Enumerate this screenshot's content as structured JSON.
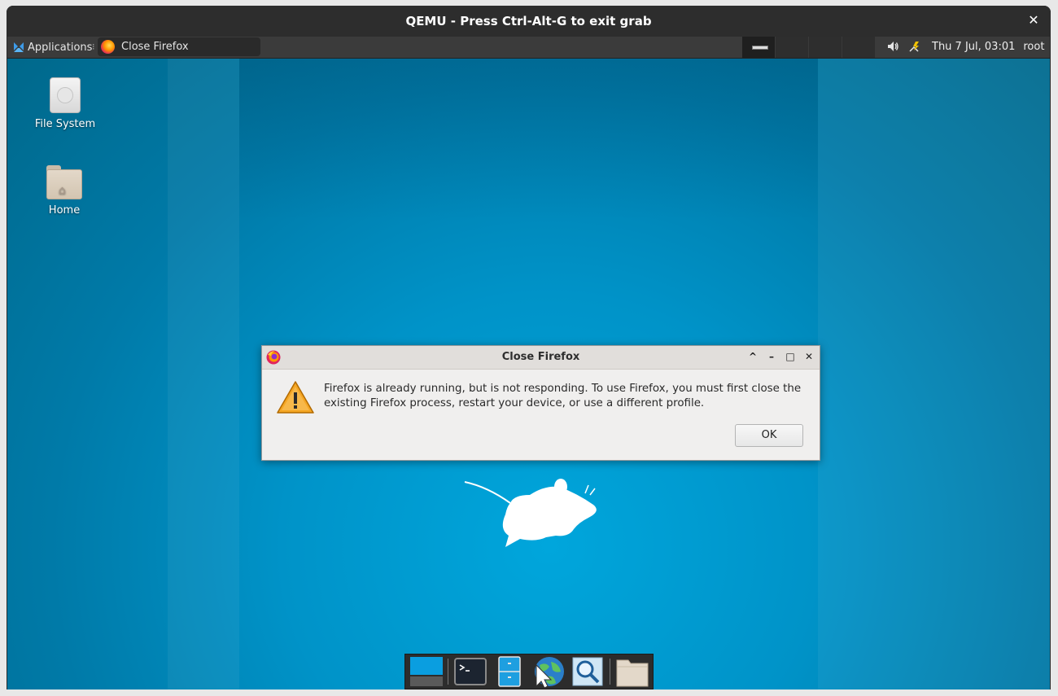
{
  "window": {
    "title": "QEMU - Press Ctrl-Alt-G to exit grab",
    "close_glyph": "✕"
  },
  "panel": {
    "applications_label": "Applications",
    "task_label": "Close Firefox",
    "clock": "Thu  7 Jul, 03:01",
    "user": "root",
    "icons": [
      "xfce-menu-icon",
      "firefox-icon",
      "volume-icon",
      "network-icon"
    ]
  },
  "desktop": {
    "icons": [
      {
        "label": "File System",
        "icon": "drive-icon"
      },
      {
        "label": "Home",
        "icon": "home-folder-icon"
      }
    ]
  },
  "dialog": {
    "title": "Close Firefox",
    "message": "Firefox is already running, but is not responding. To use Firefox, you must first close the existing Firefox process, restart your device, or use a different profile.",
    "ok_label": "OK",
    "controls": {
      "shade": "^",
      "minimize": "–",
      "maximize": "□",
      "close": "✕"
    }
  },
  "dock": {
    "items": [
      "show-desktop-icon",
      "terminal-icon",
      "file-manager-icon",
      "web-browser-icon",
      "app-finder-icon",
      "folder-icon"
    ]
  },
  "colors": {
    "desktop": "#0093c8",
    "panel": "#3b3b3b",
    "dialog_bg": "#f0efee",
    "qemu_titlebar": "#2d2d2d"
  }
}
